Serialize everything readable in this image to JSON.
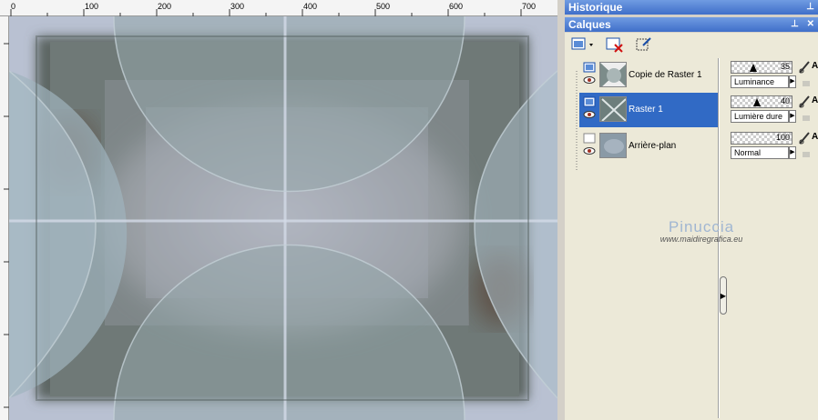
{
  "ruler": {
    "ticks": [
      "0",
      "100",
      "200",
      "300",
      "400",
      "500",
      "600",
      "700"
    ]
  },
  "panels": {
    "history_title": "Historique",
    "layers_title": "Calques"
  },
  "toolbar": {
    "icons": [
      "new-layer-icon",
      "delete-layer-icon",
      "layer-properties-icon"
    ]
  },
  "layers": [
    {
      "name": "Copie de Raster 1",
      "opacity": "35",
      "blend": "Luminance",
      "selected": false
    },
    {
      "name": "Raster 1",
      "opacity": "40",
      "blend": "Lumière dure",
      "selected": true
    },
    {
      "name": "Arrière-plan",
      "opacity": "100",
      "blend": "Normal",
      "selected": false
    }
  ],
  "props": {
    "edit_letter": "A"
  },
  "watermark": {
    "name": "Pinuccia",
    "url": "www.maidiregrafica.eu"
  },
  "colors": {
    "title_bar": "#3f6fc9",
    "selection": "#316ac5",
    "panel_bg": "#ece9d8"
  }
}
